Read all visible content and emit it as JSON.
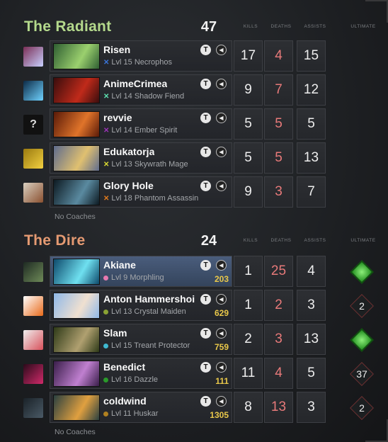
{
  "columns": {
    "kills": "KILLS",
    "deaths": "DEATHS",
    "assists": "ASSISTS",
    "ultimate": "ULTIMATE"
  },
  "colors": {
    "radiant": "#b4d98c",
    "dire": "#e59a72",
    "deaths": "#e87a7a",
    "gold": "#e9c84a",
    "highlight": "#4a5d7c"
  },
  "radiant": {
    "name": "The Radiant",
    "score": "47",
    "coaches": "No Coaches",
    "players": [
      {
        "name": "Risen",
        "level": "Lvl 15",
        "hero": "Necrophos",
        "kills": "17",
        "deaths": "4",
        "assists": "15",
        "color": "#3a74d8",
        "portrait": [
          "#2f5e32",
          "#9bd06e"
        ],
        "side": [
          "#7a2e55",
          "#c9d0ff"
        ],
        "side_icon": "player-avatar"
      },
      {
        "name": "AnimeCrimea",
        "level": "Lvl 14",
        "hero": "Shadow Fiend",
        "kills": "9",
        "deaths": "7",
        "assists": "12",
        "color": "#5de0b0",
        "portrait": [
          "#3a0d0d",
          "#c02a1a"
        ],
        "side": [
          "#0c2a46",
          "#6fd2ff"
        ],
        "side_icon": "player-avatar"
      },
      {
        "name": "revvie",
        "level": "Lvl 14",
        "hero": "Ember Spirit",
        "kills": "5",
        "deaths": "5",
        "assists": "5",
        "color": "#9b32b8",
        "portrait": [
          "#5a1a08",
          "#e0742a"
        ],
        "side": "?",
        "side_icon": "unknown-avatar"
      },
      {
        "name": "Edukatorja",
        "level": "Lvl 13",
        "hero": "Skywrath Mage",
        "kills": "5",
        "deaths": "5",
        "assists": "13",
        "color": "#d8d832",
        "portrait": [
          "#5f6c8e",
          "#e0c070"
        ],
        "side": [
          "#9a7a10",
          "#f2d040"
        ],
        "side_icon": "player-avatar"
      },
      {
        "name": "Glory Hole",
        "level": "Lvl 18",
        "hero": "Phantom Assassin",
        "kills": "9",
        "deaths": "3",
        "assists": "7",
        "color": "#e07a1e",
        "portrait": [
          "#0d1a22",
          "#5a8aa0"
        ],
        "side": [
          "#d9d0c0",
          "#8a5030"
        ],
        "side_icon": "player-avatar"
      }
    ]
  },
  "dire": {
    "name": "The Dire",
    "score": "24",
    "coaches": "No Coaches",
    "players": [
      {
        "name": "Akiane",
        "level": "Lvl 9",
        "hero": "Morphling",
        "gold": "203",
        "kills": "1",
        "deaths": "25",
        "assists": "4",
        "color": "#e879b0",
        "ult": "",
        "ult_ready": true,
        "portrait": [
          "#0e4a6c",
          "#6fe0f0"
        ],
        "side": [
          "#1e2a22",
          "#6e8a58"
        ],
        "side_icon": "player-avatar",
        "highlight": true
      },
      {
        "name": "Anton Hammershoi",
        "level": "Lvl 13",
        "hero": "Crystal Maiden",
        "gold": "629",
        "kills": "1",
        "deaths": "2",
        "assists": "3",
        "color": "#8aa234",
        "ult": "2",
        "ult_ready": false,
        "portrait": [
          "#8fb8e8",
          "#f0e0d0"
        ],
        "side": [
          "#ffffff",
          "#e86a1a"
        ],
        "side_icon": "player-avatar"
      },
      {
        "name": "Slam",
        "level": "Lvl 15",
        "hero": "Treant Protector",
        "gold": "759",
        "kills": "2",
        "deaths": "3",
        "assists": "13",
        "color": "#3fb8d0",
        "ult": "",
        "ult_ready": true,
        "portrait": [
          "#2e3a18",
          "#b0a070"
        ],
        "side": [
          "#f0f0f0",
          "#d8505a"
        ],
        "side_icon": "player-avatar"
      },
      {
        "name": "Benedict",
        "level": "Lvl 16",
        "hero": "Dazzle",
        "gold": "111",
        "kills": "11",
        "deaths": "4",
        "assists": "5",
        "color": "#2a9a2a",
        "ult": "37",
        "ult_ready": false,
        "portrait": [
          "#3a1e4a",
          "#c080d0"
        ],
        "side": [
          "#2a0a1a",
          "#d02a6a"
        ],
        "side_icon": "player-avatar"
      },
      {
        "name": "coldwind",
        "level": "Lvl 11",
        "hero": "Huskar",
        "gold": "1305",
        "kills": "8",
        "deaths": "13",
        "assists": "3",
        "color": "#b08020",
        "ult": "2",
        "ult_ready": false,
        "portrait": [
          "#2a4040",
          "#e0a040"
        ],
        "side": [
          "#1a2228",
          "#4a5a66"
        ],
        "side_icon": "player-avatar"
      }
    ]
  }
}
